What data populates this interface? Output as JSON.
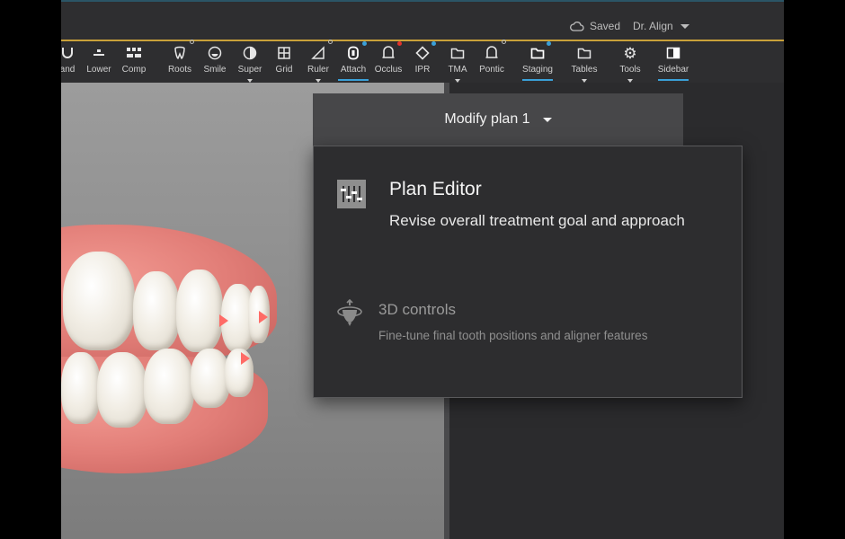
{
  "header": {
    "saved_label": "Saved",
    "user_label": "Dr. Align"
  },
  "toolbar": {
    "tools": [
      {
        "label": "and",
        "icon": "arch-icon"
      },
      {
        "label": "Lower",
        "icon": "lower-jaw-icon"
      },
      {
        "label": "Comp",
        "icon": "compare-icon"
      },
      {
        "label": "Roots",
        "icon": "tooth-roots-icon"
      },
      {
        "label": "Smile",
        "icon": "smile-icon"
      },
      {
        "label": "Super",
        "icon": "superimpose-icon"
      },
      {
        "label": "Grid",
        "icon": "grid-icon"
      },
      {
        "label": "Ruler",
        "icon": "ruler-icon"
      },
      {
        "label": "Attach",
        "icon": "attachment-icon",
        "active": true
      },
      {
        "label": "Occlus",
        "icon": "occlusion-icon"
      },
      {
        "label": "IPR",
        "icon": "ipr-icon"
      },
      {
        "label": "TMA",
        "icon": "folder-icon"
      },
      {
        "label": "Pontic",
        "icon": "pontic-icon"
      },
      {
        "label": "Staging",
        "icon": "staging-folder-icon",
        "active": true
      },
      {
        "label": "Tables",
        "icon": "tables-folder-icon"
      },
      {
        "label": "Tools",
        "icon": "gear-icon"
      },
      {
        "label": "Sidebar",
        "icon": "sidebar-icon",
        "active": true
      }
    ],
    "accent_color": "#3aa0d8",
    "alert_color": "#e2332d"
  },
  "plan": {
    "title": "Modify plan 1"
  },
  "menu": {
    "options": [
      {
        "title": "Plan Editor",
        "description": "Revise overall treatment goal and approach",
        "icon": "plan-editor-icon"
      },
      {
        "title": "3D controls",
        "description": "Fine-tune final tooth positions and aligner features",
        "icon": "3d-controls-icon"
      }
    ]
  }
}
